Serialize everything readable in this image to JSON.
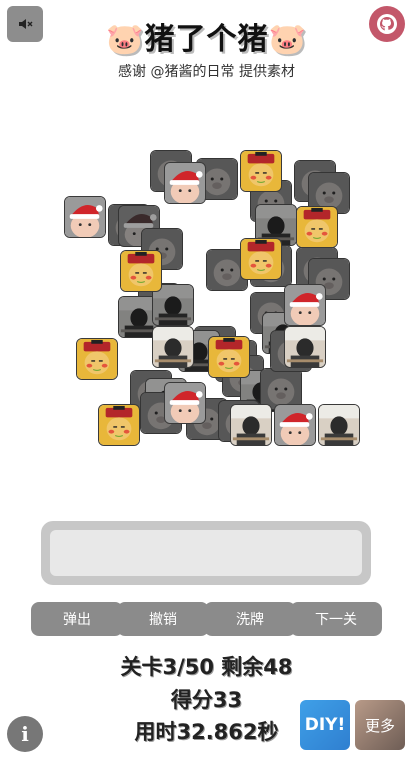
{
  "header": {
    "title": "🐷猪了个猪🐷",
    "credit": "感谢 @猪酱的日常 提供素材",
    "mute_icon": "speaker-muted-icon",
    "github_icon": "github-icon"
  },
  "board": {
    "tile_types": [
      "pig-santa-hat",
      "pig-chinese-hat",
      "man-at-desk",
      "pig-photo"
    ],
    "colors": {
      "santa_red": "#d0252a",
      "emperor_yellow": "#e8b73a",
      "emperor_red": "#b3262a",
      "skin": "#e8b77e",
      "desk": "#d9d0c4"
    }
  },
  "controls": {
    "pop_out": "弹出",
    "undo": "撤销",
    "shuffle": "洗牌",
    "next_level": "下一关"
  },
  "stats": {
    "level_line": "关卡3/50 剩余48",
    "score_line": "得分33",
    "time_line": "用时32.862秒"
  },
  "footer": {
    "info_label": "i",
    "diy_label": "DIY!",
    "more_label": "更多"
  }
}
